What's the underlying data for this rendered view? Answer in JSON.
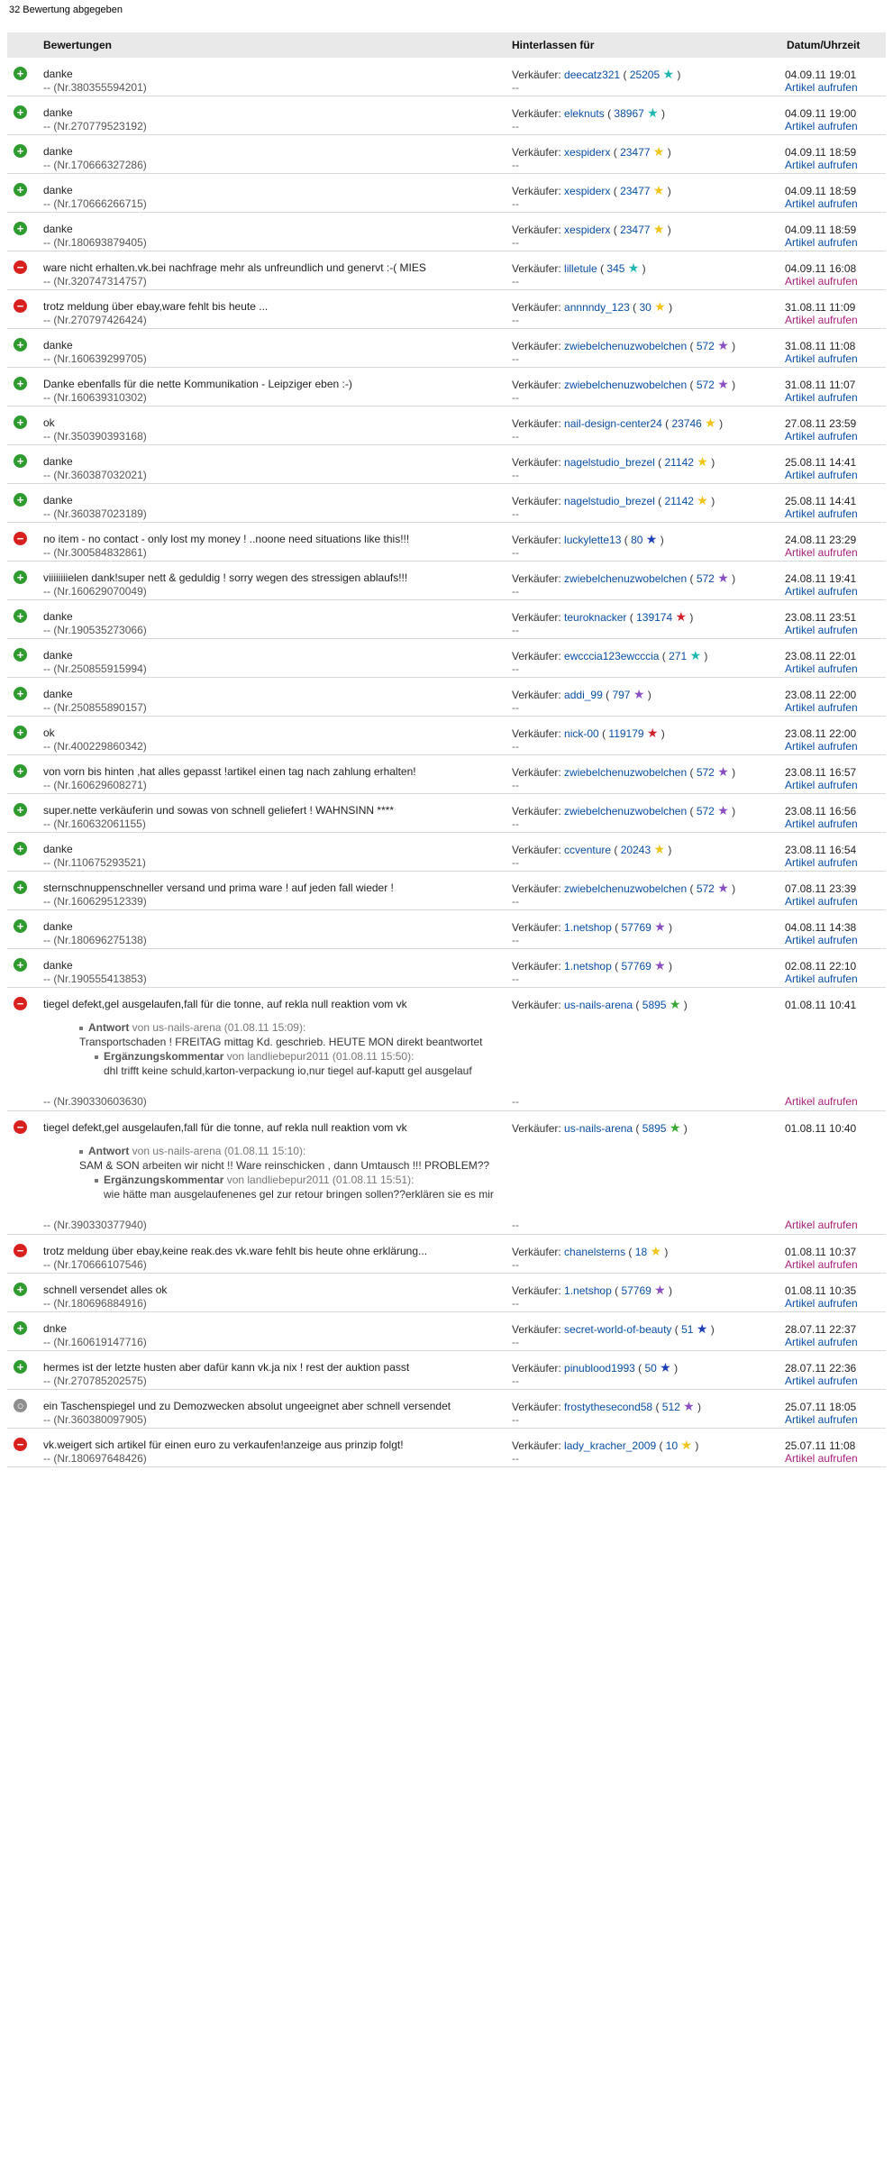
{
  "title": "32 Bewertung abgegeben",
  "headers": {
    "bewertungen": "Bewertungen",
    "hinterlassen": "Hinterlassen für",
    "datum": "Datum/Uhrzeit"
  },
  "labels": {
    "verkaeufer": "Verkäufer:",
    "artikel": "Artikel aufrufen",
    "dash": "--",
    "antwort": "Antwort",
    "antwort_von": "von",
    "ergaenzung": "Ergänzungskommentar"
  },
  "rows": [
    {
      "type": "positive",
      "comment": "danke",
      "num": "-- (Nr.380355594201)",
      "seller": "deecatz321",
      "score": "25205",
      "star": "shooting-teal",
      "date": "04.09.11 19:01"
    },
    {
      "type": "positive",
      "comment": "danke",
      "num": "-- (Nr.270779523192)",
      "seller": "eleknuts",
      "score": "38967",
      "star": "shooting-teal",
      "date": "04.09.11 19:00"
    },
    {
      "type": "positive",
      "comment": "danke",
      "num": "-- (Nr.170666327286)",
      "seller": "xespiderx",
      "score": "23477",
      "star": "shooting-yellow",
      "date": "04.09.11 18:59"
    },
    {
      "type": "positive",
      "comment": "danke",
      "num": "-- (Nr.170666266715)",
      "seller": "xespiderx",
      "score": "23477",
      "star": "shooting-yellow",
      "date": "04.09.11 18:59"
    },
    {
      "type": "positive",
      "comment": "danke",
      "num": "-- (Nr.180693879405)",
      "seller": "xespiderx",
      "score": "23477",
      "star": "shooting-yellow",
      "date": "04.09.11 18:59"
    },
    {
      "type": "negative",
      "comment": "ware nicht erhalten.vk.bei nachfrage mehr als unfreundlich und genervt :-( MIES",
      "num": "-- (Nr.320747314757)",
      "seller": "lilletule",
      "score": "345",
      "star": "teal",
      "date": "04.09.11 16:08"
    },
    {
      "type": "negative",
      "comment": "trotz meldung über ebay,ware fehlt bis heute ...",
      "num": "-- (Nr.270797426424)",
      "seller": "annnndy_123",
      "score": "30",
      "star": "yellow",
      "date": "31.08.11 11:09"
    },
    {
      "type": "positive",
      "comment": "danke",
      "num": "-- (Nr.160639299705)",
      "seller": "zwiebelchenuzwobelchen",
      "score": "572",
      "star": "purple",
      "date": "31.08.11 11:08"
    },
    {
      "type": "positive",
      "comment": "Danke ebenfalls für die nette Kommunikation - Leipziger eben :-)",
      "num": "-- (Nr.160639310302)",
      "seller": "zwiebelchenuzwobelchen",
      "score": "572",
      "star": "purple",
      "date": "31.08.11 11:07"
    },
    {
      "type": "positive",
      "comment": "ok",
      "num": "-- (Nr.350390393168)",
      "seller": "nail-design-center24",
      "score": "23746",
      "star": "shooting-yellow",
      "date": "27.08.11 23:59"
    },
    {
      "type": "positive",
      "comment": "danke",
      "num": "-- (Nr.360387032021)",
      "seller": "nagelstudio_brezel",
      "score": "21142",
      "star": "shooting-yellow",
      "date": "25.08.11 14:41"
    },
    {
      "type": "positive",
      "comment": "danke",
      "num": "-- (Nr.360387023189)",
      "seller": "nagelstudio_brezel",
      "score": "21142",
      "star": "shooting-yellow",
      "date": "25.08.11 14:41"
    },
    {
      "type": "negative",
      "comment": "no item - no contact - only lost my money ! ..noone need situations like this!!!",
      "num": "-- (Nr.300584832861)",
      "seller": "luckylette13",
      "score": "80",
      "star": "blue",
      "date": "24.08.11 23:29"
    },
    {
      "type": "positive",
      "comment": "viiiiiiiielen dank!super nett & geduldig ! sorry wegen des stressigen ablaufs!!!",
      "num": "-- (Nr.160629070049)",
      "seller": "zwiebelchenuzwobelchen",
      "score": "572",
      "star": "purple",
      "date": "24.08.11 19:41"
    },
    {
      "type": "positive",
      "comment": "danke",
      "num": "-- (Nr.190535273066)",
      "seller": "teuroknacker",
      "score": "139174",
      "star": "shooting-red",
      "date": "23.08.11 23:51"
    },
    {
      "type": "positive",
      "comment": "danke",
      "num": "-- (Nr.250855915994)",
      "seller": "ewcccia123ewcccia",
      "score": "271",
      "star": "teal",
      "date": "23.08.11 22:01"
    },
    {
      "type": "positive",
      "comment": "danke",
      "num": "-- (Nr.250855890157)",
      "seller": "addi_99",
      "score": "797",
      "star": "purple",
      "date": "23.08.11 22:00"
    },
    {
      "type": "positive",
      "comment": "ok",
      "num": "-- (Nr.400229860342)",
      "seller": "nick-00",
      "score": "119179",
      "star": "shooting-red",
      "date": "23.08.11 22:00"
    },
    {
      "type": "positive",
      "comment": "von vorn bis hinten ,hat alles gepasst !artikel einen tag nach zahlung erhalten!",
      "num": "-- (Nr.160629608271)",
      "seller": "zwiebelchenuzwobelchen",
      "score": "572",
      "star": "purple",
      "date": "23.08.11 16:57"
    },
    {
      "type": "positive",
      "comment": "super.nette verkäuferin und sowas von schnell geliefert ! WAHNSINN ****",
      "num": "-- (Nr.160632061155)",
      "seller": "zwiebelchenuzwobelchen",
      "score": "572",
      "star": "purple",
      "date": "23.08.11 16:56"
    },
    {
      "type": "positive",
      "comment": "danke",
      "num": "-- (Nr.110675293521)",
      "seller": "ccventure",
      "score": "20243",
      "star": "shooting-yellow",
      "date": "23.08.11 16:54"
    },
    {
      "type": "positive",
      "comment": "sternschnuppenschneller versand und prima ware ! auf jeden fall wieder !",
      "num": "-- (Nr.160629512339)",
      "seller": "zwiebelchenuzwobelchen",
      "score": "572",
      "star": "purple",
      "date": "07.08.11 23:39"
    },
    {
      "type": "positive",
      "comment": "danke",
      "num": "-- (Nr.180696275138)",
      "seller": "1.netshop",
      "score": "57769",
      "star": "shooting-purple",
      "date": "04.08.11 14:38"
    },
    {
      "type": "positive",
      "comment": "danke",
      "num": "-- (Nr.190555413853)",
      "seller": "1.netshop",
      "score": "57769",
      "star": "shooting-purple",
      "date": "02.08.11 22:10"
    },
    {
      "type": "negative",
      "comment": "tiegel defekt,gel ausgelaufen,fall für die tonne, auf rekla null reaktion vom vk",
      "num": "-- (Nr.390330603630)",
      "seller": "us-nails-arena",
      "score": "5895",
      "star": "green",
      "date": "01.08.11 10:41",
      "reply": {
        "by": "us-nails-arena",
        "when": "(01.08.11 15:09):",
        "text": "Transportschaden ! FREITAG mittag Kd. geschrieb. HEUTE MON direkt beantwortet",
        "ext_by": "von landliebepur2011",
        "ext_when": "(01.08.11 15:50):",
        "ext_text": "dhl trifft keine schuld,karton-verpackung io,nur tiegel auf-kaputt gel ausgelauf"
      }
    },
    {
      "type": "negative",
      "comment": "tiegel defekt,gel ausgelaufen,fall für die tonne, auf rekla null reaktion vom vk",
      "num": "-- (Nr.390330377940)",
      "seller": "us-nails-arena",
      "score": "5895",
      "star": "green",
      "date": "01.08.11 10:40",
      "reply": {
        "by": "us-nails-arena",
        "when": "(01.08.11 15:10):",
        "text": "SAM & SON arbeiten wir nicht !! Ware reinschicken , dann Umtausch !!! PROBLEM??",
        "ext_by": "von landliebepur2011",
        "ext_when": "(01.08.11 15:51):",
        "ext_text": "wie hätte man ausgelaufenenes gel zur retour bringen sollen??erklären sie es mir"
      }
    },
    {
      "type": "negative",
      "comment": "trotz meldung über ebay,keine reak.des vk.ware fehlt bis heute ohne erklärung...",
      "num": "-- (Nr.170666107546)",
      "seller": "chanelsterns",
      "score": "18",
      "star": "yellow",
      "date": "01.08.11 10:37"
    },
    {
      "type": "positive",
      "comment": "schnell versendet alles ok",
      "num": "-- (Nr.180696884916)",
      "seller": "1.netshop",
      "score": "57769",
      "star": "shooting-purple",
      "date": "01.08.11 10:35"
    },
    {
      "type": "positive",
      "comment": "dnke",
      "num": "-- (Nr.160619147716)",
      "seller": "secret-world-of-beauty",
      "score": "51",
      "star": "blue",
      "date": "28.07.11 22:37"
    },
    {
      "type": "positive",
      "comment": "hermes ist der letzte husten aber dafür kann vk.ja nix ! rest der auktion passt",
      "num": "-- (Nr.270785202575)",
      "seller": "pinublood1993",
      "score": "50",
      "star": "blue",
      "date": "28.07.11 22:36"
    },
    {
      "type": "neutral",
      "comment": "ein Taschenspiegel und zu Demozwecken absolut ungeeignet aber schnell versendet",
      "num": "-- (Nr.360380097905)",
      "seller": "frostythesecond58",
      "score": "512",
      "star": "purple",
      "date": "25.07.11 18:05"
    },
    {
      "type": "negative",
      "comment": "vk.weigert sich artikel für einen euro zu verkaufen!anzeige aus prinzip folgt!",
      "num": "-- (Nr.180697648426)",
      "seller": "lady_kracher_2009",
      "score": "10",
      "star": "yellow",
      "date": "25.07.11 11:08"
    }
  ],
  "star_colors": {
    "teal": "#1fb7b0",
    "yellow": "#f0c419",
    "purple": "#8a4fc0",
    "blue": "#1d3fb8",
    "red": "#d0202a",
    "green": "#3aa637"
  }
}
